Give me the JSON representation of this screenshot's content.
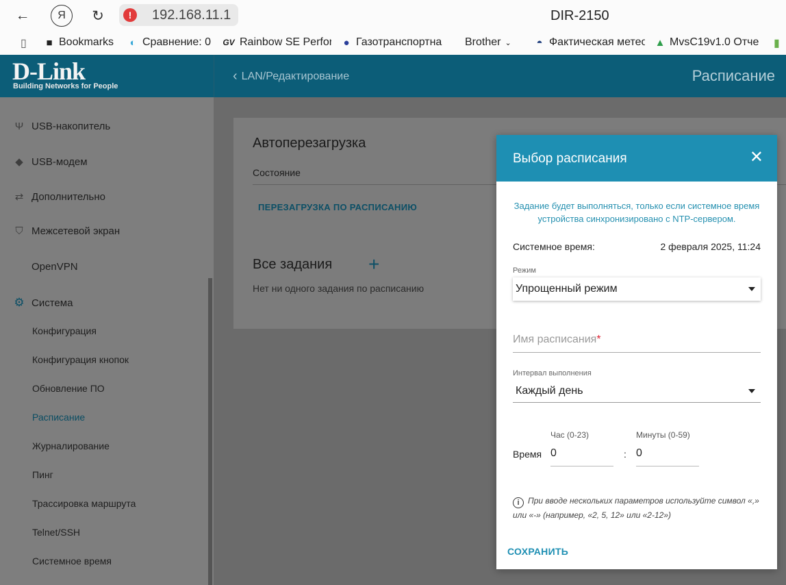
{
  "browser": {
    "back_icon": "arrow-left-icon",
    "yandex_glyph": "Я",
    "url": "192.168.11.1",
    "page_title": "DIR-2150",
    "bookmarks": [
      {
        "label": "Bookmarks",
        "icon": "bookmark-icon"
      },
      {
        "label": "Сравнение: 0",
        "icon": "drop-icon"
      },
      {
        "label": "Rainbow SE Perfor",
        "icon": "gv-logo-icon"
      },
      {
        "label": "Газотранспортна",
        "icon": "flame-icon"
      },
      {
        "label": "Brother",
        "icon": "none"
      },
      {
        "label": "Фактическая метео",
        "icon": "weather-icon"
      },
      {
        "label": "MvsC19v1.0 Отче",
        "icon": "drive-icon"
      }
    ]
  },
  "header": {
    "logo_text": "D-Link",
    "logo_tagline": "Building Networks for People",
    "back_label": "LAN/Редактирование",
    "title": "Расписание"
  },
  "sidebar": {
    "items": [
      {
        "label": "USB-накопитель",
        "icon": "usb-icon"
      },
      {
        "label": "USB-модем",
        "icon": "modem-icon"
      },
      {
        "label": "Дополнительно",
        "icon": "arrows-icon"
      },
      {
        "label": "Межсетевой экран",
        "icon": "shield-icon"
      },
      {
        "label": "OpenVPN",
        "icon": "none"
      },
      {
        "label": "Система",
        "icon": "gear-icon"
      }
    ],
    "subitems": [
      "Конфигурация",
      "Конфигурация кнопок",
      "Обновление ПО",
      "Расписание",
      "Журналирование",
      "Пинг",
      "Трассировка маршрута",
      "Telnet/SSH",
      "Системное время"
    ],
    "active_subitem": "Расписание"
  },
  "card": {
    "title": "Автоперезагрузка",
    "state_label": "Состояние",
    "schedule_link": "ПЕРЕЗАГРУЗКА ПО РАСПИСАНИЮ",
    "all_tasks": "Все задания",
    "plus": "+",
    "empty": "Нет ни одного задания по расписанию"
  },
  "modal": {
    "title": "Выбор расписания",
    "close": "✕",
    "note": "Задание будет выполняться, только если системное время устройства синхронизировано с NTP-сервером.",
    "system_time_label": "Системное время:",
    "system_time_value": "2 февраля 2025, 11:24",
    "mode_label": "Режим",
    "mode_value": "Упрощенный режим",
    "name_placeholder": "Имя расписания",
    "name_required": "*",
    "interval_label": "Интервал выполнения",
    "interval_value": "Каждый день",
    "time_label": "Время",
    "hour_label": "Час (0-23)",
    "hour_value": "0",
    "minute_label": "Минуты (0-59)",
    "minute_value": "0",
    "colon": ":",
    "info_glyph": "i",
    "hint": "При вводе нескольких параметров используйте символ «,» или «-» (например, «2, 5, 12» или «2-12»)",
    "save": "СОХРАНИТЬ"
  },
  "colors": {
    "header": "#0c5d78",
    "modal_header": "#1e8fb3",
    "accent": "#1e8fb3"
  }
}
